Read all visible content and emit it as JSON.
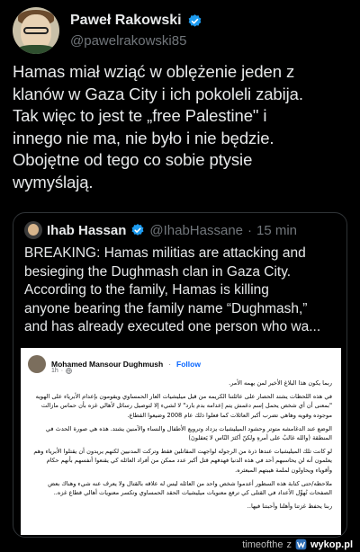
{
  "author": {
    "name": "Paweł Rakowski",
    "handle": "@pawelrakowski85"
  },
  "tweet": {
    "text": "Hamas miał wziąć w oblężenie jeden z\nklanów w Gaza City i ich pokoleli zabija.\nTak więc to jest te „free Palestine\" i\ninnego nie ma, nie było i nie będzie.\nObojętne od tego co sobie ptysie\nwymyślają."
  },
  "quoted": {
    "name": "Ihab Hassan",
    "handle": "@IhabHassane",
    "separator": "·",
    "time": "15 min",
    "text": "BREAKING: Hamas militias are attacking and\nbesieging the Dughmash clan in Gaza City.\nAccording to the family, Hamas is killing\nanyone bearing the family name “Dughmash,”\nand has already executed one person who wa..."
  },
  "facebook_post": {
    "name": "Mohamed Mansour Dughmush",
    "dot": "·",
    "follow": "Follow",
    "time": "1h",
    "paragraphs": [
      "ربما يكون هذا البلاغ الأخير لمن يهمه الأمر.",
      "في هذه اللحظات يشتد الحصار على عائلتنا الكريمه من قبل ميليشيات العار الحمساوي ويقومون بإعدام الأبرياء على الهويه \"بمعنى أن أي شخص يحمل إسم دغمش يتم إعدامه بدم بارد\" لا لشيء إلا لتوصيل رسائل لأهالي غزه بأن حماس مازالت موجوده وقويه وهاهي تضرب أكبر العائلات كما فعلوا ذلك عام 2008 وضيعوا القطاع.",
      "الوضع عند الدغامشه متوتر وحشود الميليشيات يزداد وترويع الأطفال والنساء والآمنين يشتد. هذه هي صورة الحدث في المنطقة (والله غالبٌ على أمرهِ ولكنّ أكثرَ النّاس لا يَعقلونَ)",
      "لو كانت تلك الميليشيات عندها ذرة من الرجوله لواجهت المقاتلين فقط وتركت المدنيين لكنهم يريدون أن يقتلوا الأبرياء وهم يعلمون أنه لن يحاسبهم أحد في هذه الدنيا فهدفهم قتل أكبر عدد ممكن من أفراد العائله كي يقنعوا أنفسهم بأنهم حكام وأقوياء ويحاولون لملمة هيبتهم المبعثره.",
      "ملاحظه/حتى كتابة هذه السطور أعدموا شخص واحد من العائله ليس له علاقه بالقتال ولا يعرف عنه شيء وهناك بعض الصفحات تُهوِّل الأعداد في القتلى كي ترفع معنويات ميليشيات الحقد الحمساوي وتكسر معنويات أهالي قطاع غزه..",
      "ربنا يحفظ غزتنا وأهلنا وأحبتنا فيها.."
    ]
  },
  "footer": {
    "source": "timeofthe",
    "sep": "z",
    "brand": "wykop.pl"
  },
  "colors": {
    "background": "#000000",
    "text": "#e7e9ea",
    "secondary": "#71767b",
    "verified": "#1d9bf0",
    "border": "#2f3336"
  },
  "icons": [
    "verified-badge-icon",
    "globe-icon",
    "wykop-logo-icon"
  ]
}
